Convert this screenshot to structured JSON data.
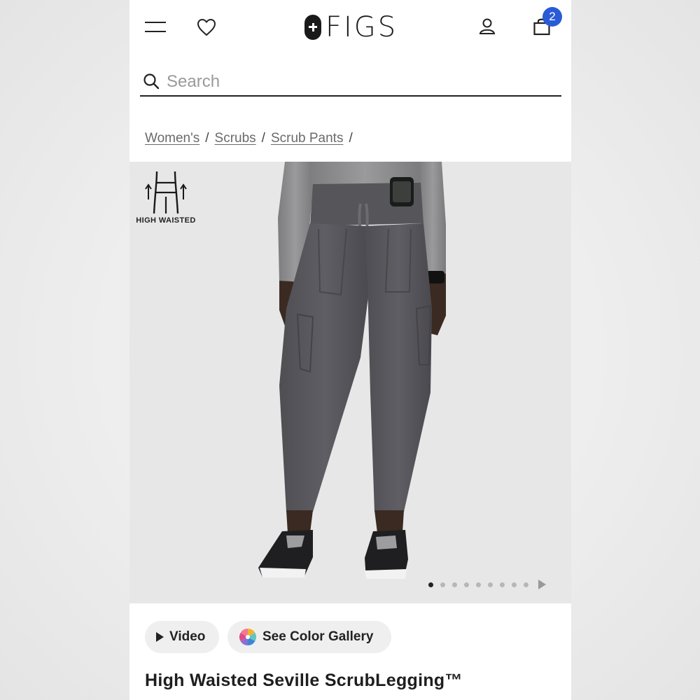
{
  "header": {
    "logo_text": "FIGS",
    "cart_count": "2",
    "accent_color": "#2a5bd7"
  },
  "search": {
    "placeholder": "Search"
  },
  "breadcrumb": {
    "items": [
      "Women's",
      "Scrubs",
      "Scrub Pants"
    ],
    "separator": "/"
  },
  "product_image": {
    "badge_label": "HIGH WAISTED",
    "gallery_dots": 9,
    "active_dot": 1
  },
  "actions": {
    "video_label": "Video",
    "gallery_label": "See Color Gallery"
  },
  "product": {
    "title": "High Waisted Seville ScrubLegging™"
  },
  "icons": [
    "menu-icon",
    "heart-icon",
    "account-icon",
    "bag-icon",
    "search-icon",
    "play-icon",
    "color-wheel-icon",
    "chevron-right-icon"
  ]
}
